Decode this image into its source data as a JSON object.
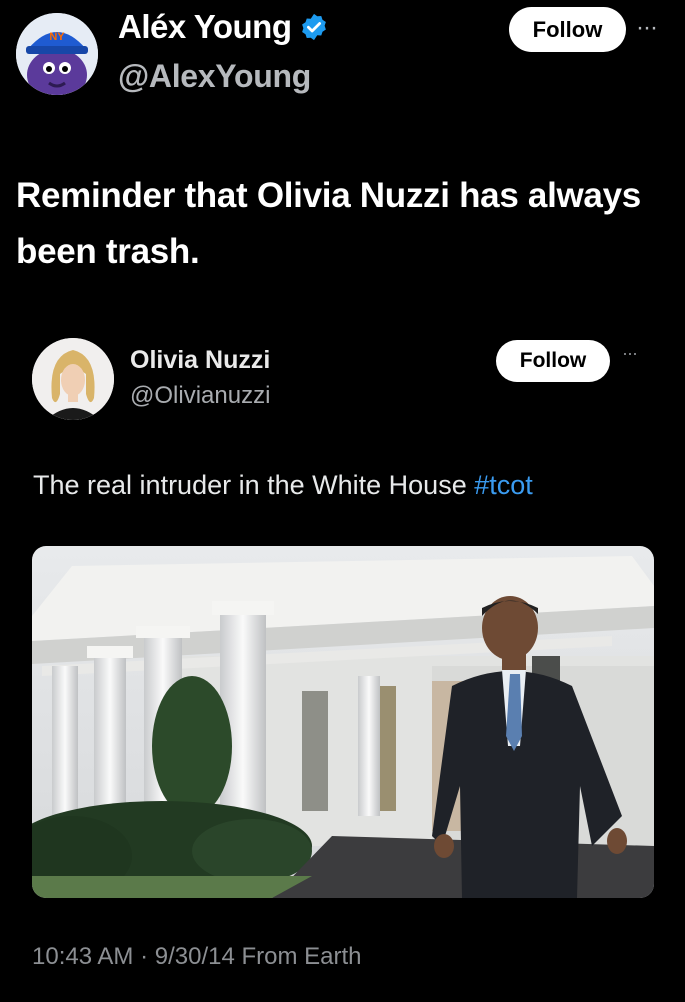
{
  "author": {
    "name": "Aléx Young",
    "handle": "@AlexYoung",
    "verified": true,
    "avatar_icon": "mets-cap-mascot-avatar-icon"
  },
  "follow_label": "Follow",
  "more_label": "···",
  "tweet": {
    "text": "Reminder that Olivia Nuzzi has always been trash."
  },
  "quoted": {
    "name": "Olivia Nuzzi",
    "handle": "@Olivianuzzi",
    "follow_label": "Follow",
    "more_label": "···",
    "text": "The real intruder in the White House",
    "hashtag": "#tcot",
    "meta": "10:43 AM · 9/30/14 From Earth"
  },
  "colors": {
    "background": "#000000",
    "verified": "#1d9bf0",
    "hashtag": "#3a9bf0"
  }
}
